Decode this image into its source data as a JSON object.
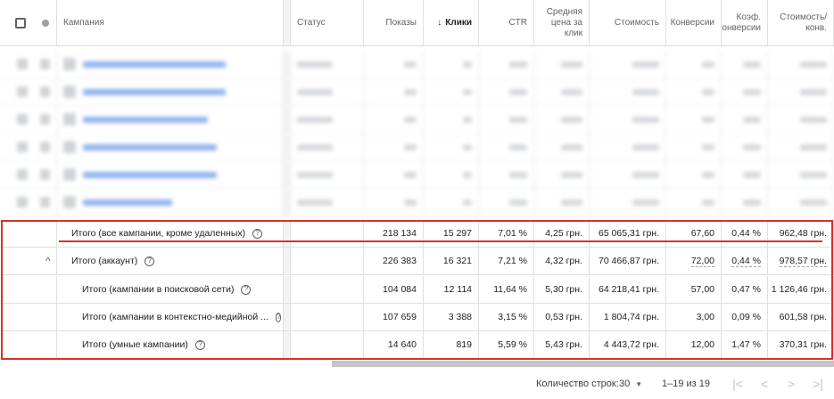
{
  "header": {
    "campaign": "Кампания",
    "status": "Статус",
    "impressions": "Показы",
    "clicks": "Клики",
    "sort_arrow": "↓",
    "ctr": "CTR",
    "avg_cpc": "Средняя цена за клик",
    "cost": "Стоимость",
    "conversions": "Конверсии",
    "conv_rate": "Коэф. конверсии",
    "cost_per_conv": "Стоимость/ конв."
  },
  "totals": [
    {
      "label": "Итого (все кампании, кроме удаленных)",
      "expander": "",
      "impressions": "218 134",
      "clicks": "15 297",
      "ctr": "7,01 %",
      "avg_cpc": "4,25 грн.",
      "cost": "65 065,31 грн.",
      "conversions": "67,60",
      "conv_rate": "0,44 %",
      "cost_per_conv": "962,48 грн."
    },
    {
      "label": "Итого (аккаунт)",
      "expander": "^",
      "impressions": "226 383",
      "clicks": "16 321",
      "ctr": "7,21 %",
      "avg_cpc": "4,32 грн.",
      "cost": "70 466,87 грн.",
      "conversions": "72,00",
      "conv_rate": "0,44 %",
      "cost_per_conv": "978,57 грн."
    },
    {
      "label": "Итого (кампании в поисковой сети)",
      "expander": "",
      "impressions": "104 084",
      "clicks": "12 114",
      "ctr": "11,64 %",
      "avg_cpc": "5,30 грн.",
      "cost": "64 218,41 грн.",
      "conversions": "57,00",
      "conv_rate": "0,47 %",
      "cost_per_conv": "1 126,46 грн."
    },
    {
      "label": "Итого (кампании в контекстно-медийной ...",
      "expander": "",
      "impressions": "107 659",
      "clicks": "3 388",
      "ctr": "3,15 %",
      "avg_cpc": "0,53 грн.",
      "cost": "1 804,74 грн.",
      "conversions": "3,00",
      "conv_rate": "0,09 %",
      "cost_per_conv": "601,58 грн."
    },
    {
      "label": "Итого (умные кампании)",
      "expander": "",
      "impressions": "14 640",
      "clicks": "819",
      "ctr": "5,59 %",
      "avg_cpc": "5,43 грн.",
      "cost": "4 443,72 грн.",
      "conversions": "12,00",
      "conv_rate": "1,47 %",
      "cost_per_conv": "370,31 грн."
    }
  ],
  "help_icon": "?",
  "footer": {
    "rows_label": "Количество строк:",
    "rows_value": "30",
    "range": "1–19 из 19"
  },
  "colors": {
    "highlight": "#d93025",
    "link": "#1a73e8"
  }
}
